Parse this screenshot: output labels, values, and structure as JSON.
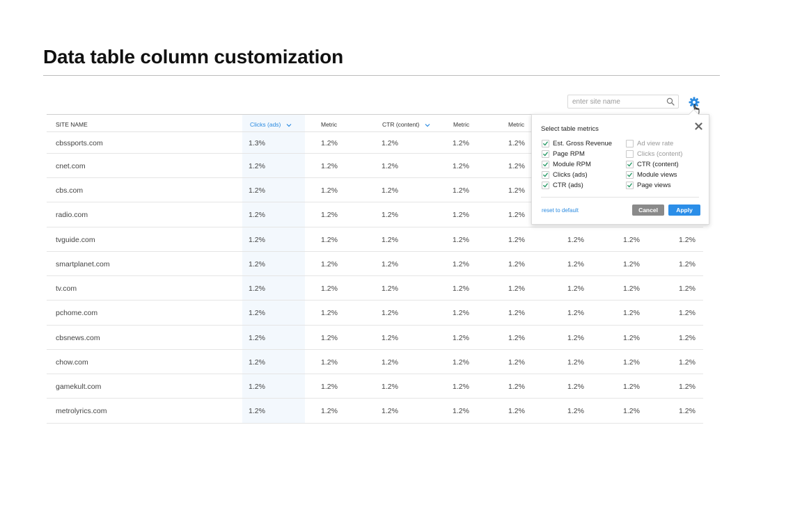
{
  "page": {
    "title": "Data table column customization"
  },
  "search": {
    "placeholder": "enter site name",
    "value": ""
  },
  "colors": {
    "accent": "#2a8ae0",
    "highlight_column": "#f3f8fd",
    "checkbox_green": "#2e9c6a",
    "cancel_button": "#8a8a8a",
    "apply_button": "#2b8ee8"
  },
  "icons": {
    "search": "search-icon",
    "settings": "gear-icon",
    "cursor": "hand-pointer-icon",
    "close": "close-icon",
    "sort": "chevron-down-icon",
    "check": "check-icon"
  },
  "table": {
    "headers": [
      {
        "label": "SITE NAME",
        "sortable": false,
        "active": false
      },
      {
        "label": "Clicks (ads)",
        "sortable": true,
        "active": true
      },
      {
        "label": "Metric",
        "sortable": false,
        "active": false
      },
      {
        "label": "CTR (content)",
        "sortable": true,
        "active": false
      },
      {
        "label": "Metric",
        "sortable": false,
        "active": false
      },
      {
        "label": "Metric",
        "sortable": false,
        "active": false
      }
    ],
    "rows": [
      {
        "site": "cbssports.com",
        "values": [
          "1.3%",
          "1.2%",
          "1.2%",
          "1.2%",
          "1.2%",
          "",
          "",
          ""
        ]
      },
      {
        "site": "cnet.com",
        "values": [
          "1.2%",
          "1.2%",
          "1.2%",
          "1.2%",
          "1.2%",
          "",
          "",
          ""
        ]
      },
      {
        "site": "cbs.com",
        "values": [
          "1.2%",
          "1.2%",
          "1.2%",
          "1.2%",
          "1.2%",
          "",
          "",
          ""
        ]
      },
      {
        "site": "radio.com",
        "values": [
          "1.2%",
          "1.2%",
          "1.2%",
          "1.2%",
          "1.2%",
          "",
          "",
          ""
        ]
      },
      {
        "site": "tvguide.com",
        "values": [
          "1.2%",
          "1.2%",
          "1.2%",
          "1.2%",
          "1.2%",
          "1.2%",
          "1.2%",
          "1.2%"
        ]
      },
      {
        "site": "smartplanet.com",
        "values": [
          "1.2%",
          "1.2%",
          "1.2%",
          "1.2%",
          "1.2%",
          "1.2%",
          "1.2%",
          "1.2%"
        ]
      },
      {
        "site": "tv.com",
        "values": [
          "1.2%",
          "1.2%",
          "1.2%",
          "1.2%",
          "1.2%",
          "1.2%",
          "1.2%",
          "1.2%"
        ]
      },
      {
        "site": "pchome.com",
        "values": [
          "1.2%",
          "1.2%",
          "1.2%",
          "1.2%",
          "1.2%",
          "1.2%",
          "1.2%",
          "1.2%"
        ]
      },
      {
        "site": "cbsnews.com",
        "values": [
          "1.2%",
          "1.2%",
          "1.2%",
          "1.2%",
          "1.2%",
          "1.2%",
          "1.2%",
          "1.2%"
        ]
      },
      {
        "site": "chow.com",
        "values": [
          "1.2%",
          "1.2%",
          "1.2%",
          "1.2%",
          "1.2%",
          "1.2%",
          "1.2%",
          "1.2%"
        ]
      },
      {
        "site": "gamekult.com",
        "values": [
          "1.2%",
          "1.2%",
          "1.2%",
          "1.2%",
          "1.2%",
          "1.2%",
          "1.2%",
          "1.2%"
        ]
      },
      {
        "site": "metrolyrics.com",
        "values": [
          "1.2%",
          "1.2%",
          "1.2%",
          "1.2%",
          "1.2%",
          "1.2%",
          "1.2%",
          "1.2%"
        ]
      }
    ]
  },
  "popover": {
    "title": "Select table metrics",
    "metrics": [
      {
        "label": "Est. Gross Revenue",
        "checked": true
      },
      {
        "label": "Page RPM",
        "checked": true
      },
      {
        "label": "Module RPM",
        "checked": true
      },
      {
        "label": "Clicks (ads)",
        "checked": true
      },
      {
        "label": "CTR (ads)",
        "checked": true
      },
      {
        "label": "Ad view rate",
        "checked": false
      },
      {
        "label": "Clicks (content)",
        "checked": false
      },
      {
        "label": "CTR (content)",
        "checked": true
      },
      {
        "label": "Module views",
        "checked": true
      },
      {
        "label": "Page views",
        "checked": true
      }
    ],
    "reset_label": "reset to default",
    "cancel_label": "Cancel",
    "apply_label": "Apply"
  }
}
